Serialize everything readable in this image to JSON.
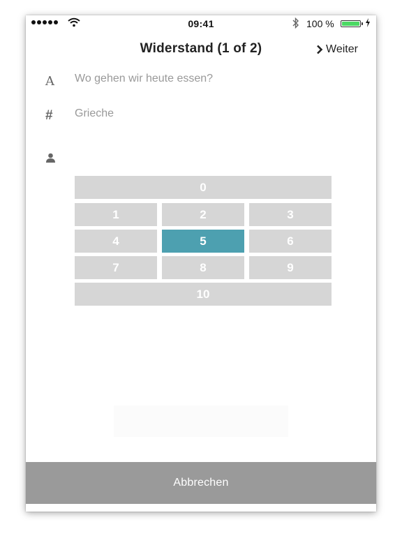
{
  "status_bar": {
    "time": "09:41",
    "battery_text": "100 %",
    "battery_level": 1.0
  },
  "nav": {
    "title": "Widerstand (1 of 2)",
    "next_label": "Weiter",
    "next_icon": "chevron-right-icon"
  },
  "form": {
    "question": "Wo gehen wir heute essen?",
    "option": "Grieche",
    "icons": [
      "text-format-icon",
      "hash-icon",
      "person-icon"
    ]
  },
  "keypad": {
    "keys": [
      "0",
      "1",
      "2",
      "3",
      "4",
      "5",
      "6",
      "7",
      "8",
      "9",
      "10"
    ],
    "selected": "5",
    "selected_color": "#4da0b0",
    "key_color": "#d6d6d6"
  },
  "footer": {
    "cancel_label": "Abbrechen"
  }
}
